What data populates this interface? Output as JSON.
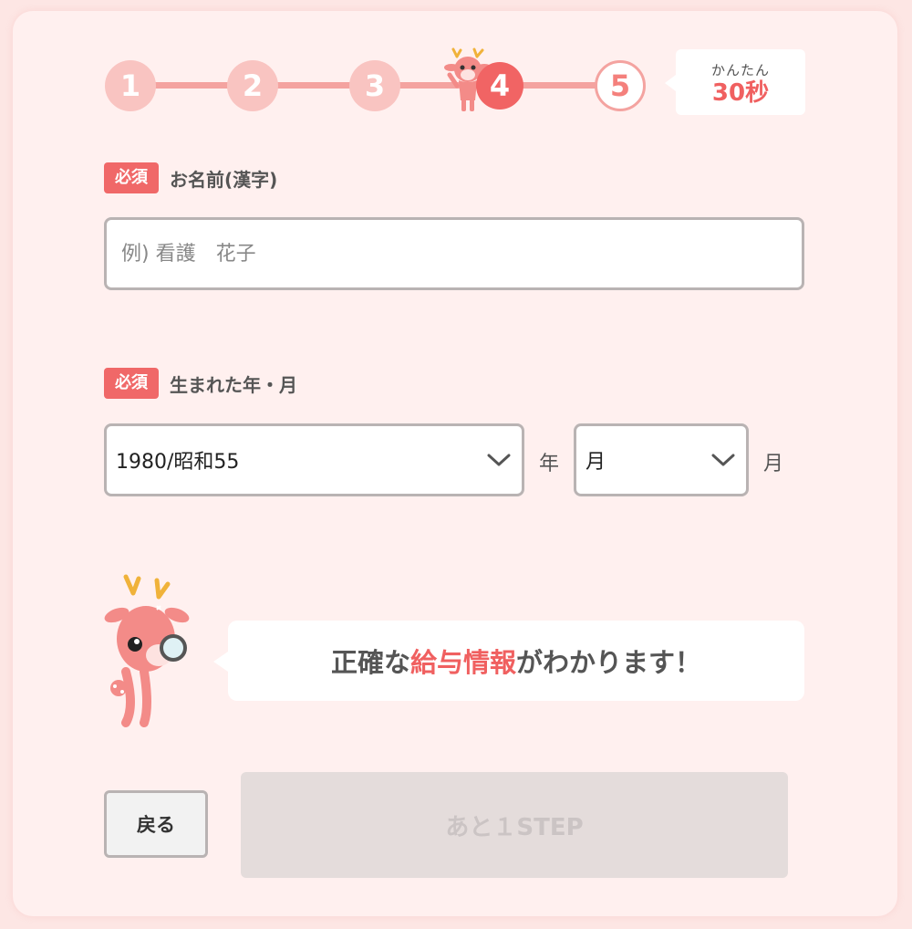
{
  "stepper": {
    "steps": [
      "1",
      "2",
      "3",
      "4",
      "5"
    ],
    "current_step": 4,
    "time_label_top": "かんたん",
    "time_label_bottom": "30秒"
  },
  "form": {
    "name_field": {
      "badge": "必須",
      "label": "お名前(漢字)",
      "placeholder": "例) 看護　花子",
      "value": ""
    },
    "birth_field": {
      "badge": "必須",
      "label": "生まれた年・月",
      "year_value": "1980/昭和55",
      "year_unit": "年",
      "month_value": "月",
      "month_unit": "月"
    }
  },
  "message": {
    "prefix": "正確な",
    "highlight": "給与情報",
    "suffix": "がわかります！"
  },
  "buttons": {
    "back_label": "戻る",
    "next_label": "あと１STEP"
  },
  "colors": {
    "accent": "#f06060",
    "background": "#fff0ef",
    "disabled_button": "#e4dcdb"
  },
  "icons": {
    "stepper_mascot": "deer-mascot-icon",
    "message_mascot": "deer-with-magnifier-icon",
    "select_arrow": "chevron-down-icon"
  }
}
